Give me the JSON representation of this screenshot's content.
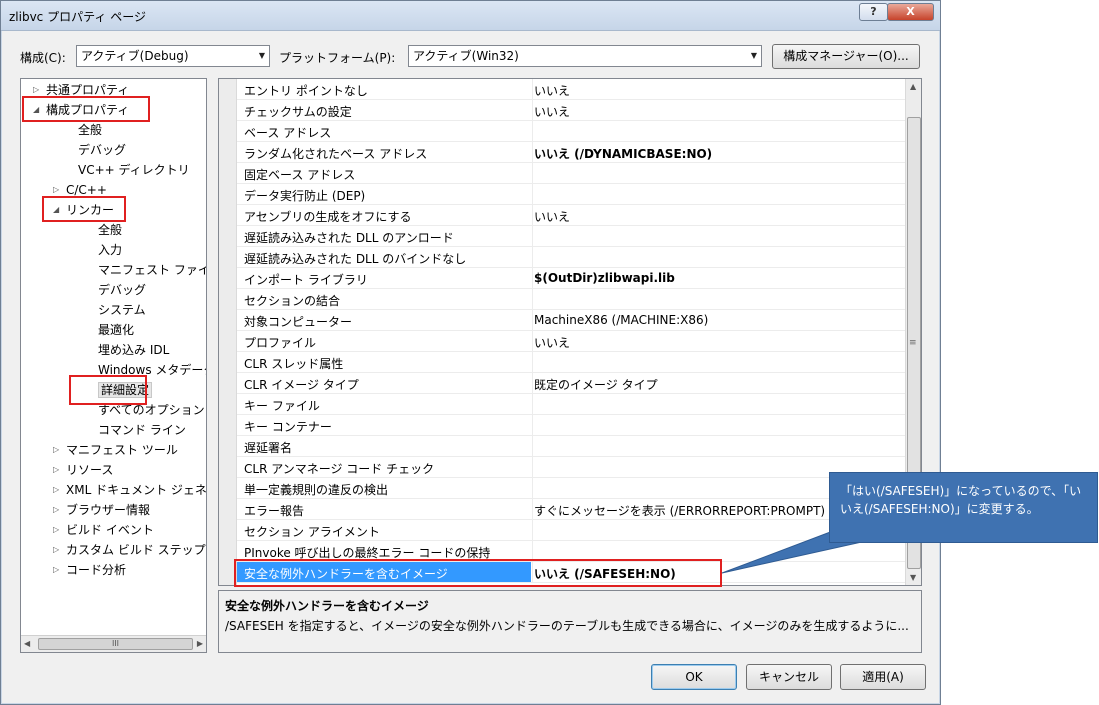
{
  "window": {
    "title": "zlibvc プロパティ ページ",
    "help_label": "?",
    "close_label": "X"
  },
  "toolbar": {
    "config_label": "構成(C):",
    "config_value": "アクティブ(Debug)",
    "platform_label": "プラットフォーム(P):",
    "platform_value": "アクティブ(Win32)",
    "config_manager_label": "構成マネージャー(O)..."
  },
  "tree": {
    "items": [
      {
        "label": "共通プロパティ",
        "state": "collapsed"
      },
      {
        "label": "構成プロパティ",
        "state": "expanded"
      },
      {
        "label": "全般"
      },
      {
        "label": "デバッグ"
      },
      {
        "label": "VC++ ディレクトリ"
      },
      {
        "label": "C/C++",
        "state": "collapsed"
      },
      {
        "label": "リンカー",
        "state": "expanded"
      },
      {
        "label": "全般"
      },
      {
        "label": "入力"
      },
      {
        "label": "マニフェスト ファイル"
      },
      {
        "label": "デバッグ"
      },
      {
        "label": "システム"
      },
      {
        "label": "最適化"
      },
      {
        "label": "埋め込み IDL"
      },
      {
        "label": "Windows メタデータ"
      },
      {
        "label": "詳細設定",
        "selected": true
      },
      {
        "label": "すべてのオプション"
      },
      {
        "label": "コマンド ライン"
      },
      {
        "label": "マニフェスト ツール",
        "state": "collapsed"
      },
      {
        "label": "リソース",
        "state": "collapsed"
      },
      {
        "label": "XML ドキュメント ジェネ",
        "state": "collapsed"
      },
      {
        "label": "ブラウザー情報",
        "state": "collapsed"
      },
      {
        "label": "ビルド イベント",
        "state": "collapsed"
      },
      {
        "label": "カスタム ビルド ステップ",
        "state": "collapsed"
      },
      {
        "label": "コード分析",
        "state": "collapsed"
      }
    ],
    "hscroll_grip": "III"
  },
  "grid": {
    "rows": [
      {
        "name": "エントリ ポイントなし",
        "value": "いいえ"
      },
      {
        "name": "チェックサムの設定",
        "value": "いいえ"
      },
      {
        "name": "ベース アドレス",
        "value": ""
      },
      {
        "name": "ランダム化されたベース アドレス",
        "value": "いいえ (/DYNAMICBASE:NO)",
        "bold": true
      },
      {
        "name": "固定ベース アドレス",
        "value": ""
      },
      {
        "name": "データ実行防止 (DEP)",
        "value": ""
      },
      {
        "name": "アセンブリの生成をオフにする",
        "value": "いいえ"
      },
      {
        "name": "遅延読み込みされた DLL のアンロード",
        "value": ""
      },
      {
        "name": "遅延読み込みされた DLL のバインドなし",
        "value": ""
      },
      {
        "name": "インポート ライブラリ",
        "value": "$(OutDir)zlibwapi.lib",
        "bold": true
      },
      {
        "name": "セクションの結合",
        "value": ""
      },
      {
        "name": "対象コンピューター",
        "value": "MachineX86 (/MACHINE:X86)"
      },
      {
        "name": "プロファイル",
        "value": "いいえ"
      },
      {
        "name": "CLR スレッド属性",
        "value": ""
      },
      {
        "name": "CLR イメージ タイプ",
        "value": "既定のイメージ タイプ"
      },
      {
        "name": "キー ファイル",
        "value": ""
      },
      {
        "name": "キー コンテナー",
        "value": ""
      },
      {
        "name": "遅延署名",
        "value": ""
      },
      {
        "name": "CLR アンマネージ コード チェック",
        "value": ""
      },
      {
        "name": "単一定義規則の違反の検出",
        "value": ""
      },
      {
        "name": "エラー報告",
        "value": "すぐにメッセージを表示 (/ERRORREPORT:PROMPT)"
      },
      {
        "name": "セクション アライメント",
        "value": ""
      },
      {
        "name": "PInvoke 呼び出しの最終エラー コードの保持",
        "value": ""
      },
      {
        "name": "安全な例外ハンドラーを含むイメージ",
        "value": "いいえ (/SAFESEH:NO)",
        "bold": true,
        "selected": true
      }
    ]
  },
  "description": {
    "title": "安全な例外ハンドラーを含むイメージ",
    "text": "/SAFESEH を指定すると、イメージの安全な例外ハンドラーのテーブルも生成できる場合に、イメージのみを生成するように..."
  },
  "buttons": {
    "ok": "OK",
    "cancel": "キャンセル",
    "apply": "適用(A)"
  },
  "callout": {
    "text": "「はい(/SAFESEH)」になっているので、「いいえ(/SAFESEH:NO)」に変更する。"
  },
  "colors": {
    "highlight": "#e02020",
    "selection": "#3399ff",
    "callout": "#3f72b1"
  }
}
